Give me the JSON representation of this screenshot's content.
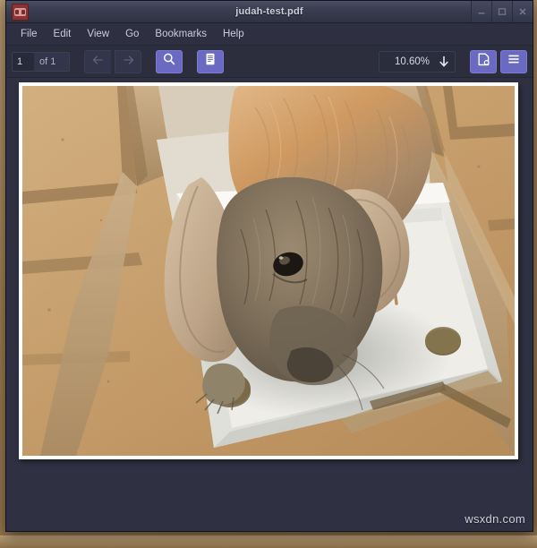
{
  "window": {
    "title": "judah-test.pdf",
    "app_icon": "atril-glasses-icon",
    "controls": {
      "minimize": "minimize-icon",
      "maximize": "maximize-icon",
      "close": "close-icon"
    }
  },
  "menubar": {
    "items": [
      {
        "label": "File"
      },
      {
        "label": "Edit"
      },
      {
        "label": "View"
      },
      {
        "label": "Go"
      },
      {
        "label": "Bookmarks"
      },
      {
        "label": "Help"
      }
    ]
  },
  "toolbar": {
    "page_number": "1",
    "page_total_label": "of 1",
    "previous_page_icon": "arrow-left-icon",
    "next_page_icon": "arrow-right-icon",
    "find_icon": "search-icon",
    "sidebar_icon": "sidebar-document-icon",
    "zoom_level": "10.60%",
    "zoom_dropdown_icon": "arrow-down-icon",
    "page_setup_icon": "page-properties-gear-icon",
    "menu_icon": "hamburger-menu-icon"
  },
  "document": {
    "page_label": "1",
    "content_description": "photograph of a lop-eared rabbit standing on white foam packaging inside a cardboard box on a tile floor"
  },
  "watermark": {
    "text": "wsxdn.com"
  },
  "colors": {
    "accent": "#6a6ac2",
    "titlebar": "#3b3e50",
    "chrome": "#2e3042",
    "desktop": "#a98a5e",
    "page": "#ffffff"
  }
}
